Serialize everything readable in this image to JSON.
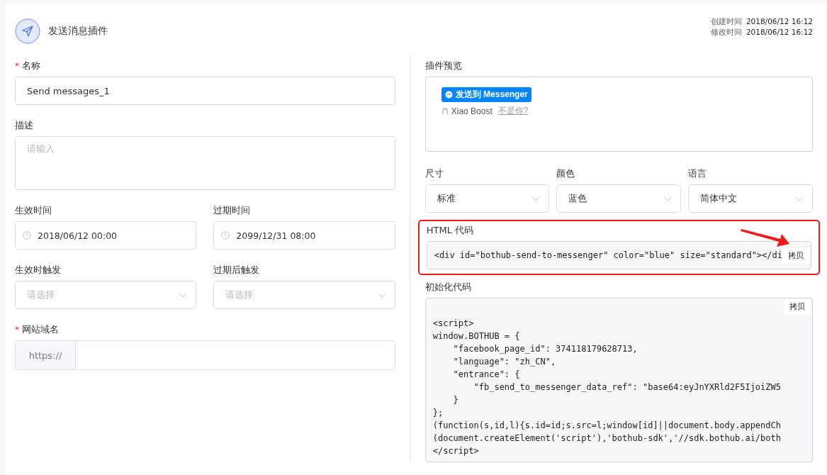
{
  "header": {
    "title": "发送消息插件",
    "created_label": "创建时间",
    "created": "2018/06/12 16:12",
    "modified_label": "修改时间",
    "modified": "2018/06/12 16:12"
  },
  "form": [
    [
      {
        "kind": "text",
        "required_mark": "*",
        "label": "名称",
        "value": "Send messages_1"
      }
    ],
    [
      {
        "kind": "textarea",
        "label": "描述",
        "placeholder": "请输入"
      }
    ],
    [
      {
        "kind": "date",
        "label": "生效时间",
        "value": "2018/06/12 00:00"
      },
      {
        "kind": "date",
        "label": "过期时间",
        "value": "2099/12/31 08:00"
      }
    ],
    [
      {
        "kind": "select",
        "label": "生效时触发",
        "placeholder": "请选择"
      },
      {
        "kind": "select",
        "label": "过期后触发",
        "placeholder": "请选择"
      }
    ],
    [
      {
        "kind": "addon",
        "required_mark": "*",
        "label": "网站域名",
        "prefix": "https://"
      }
    ]
  ],
  "preview": {
    "label": "插件预览",
    "button": "发送到 Messenger",
    "user": "Xiao Boost",
    "link": "不是你?"
  },
  "options": [
    {
      "label": "尺寸",
      "value": "标准"
    },
    {
      "label": "颜色",
      "value": "蓝色"
    },
    {
      "label": "语言",
      "value": "简体中文"
    }
  ],
  "html_code": {
    "label": "HTML 代码",
    "code": "<div id=\"bothub-send-to-messenger\" color=\"blue\" size=\"standard\"></di",
    "copy": "拷贝"
  },
  "init_code": {
    "label": "初始化代码",
    "copy": "拷贝",
    "lines": [
      "<script>",
      "window.BOTHUB = {",
      "    \"facebook_page_id\": 374118179628713,",
      "    \"language\": \"zh_CN\",",
      "    \"entrance\": {",
      "        \"fb_send_to_messenger_data_ref\": \"base64:eyJnYXRld2F5IjoiZW5",
      "    }",
      "};",
      "(function(s,id,l){s.id=id;s.src=l;window[id]||document.body.appendCh",
      "(document.createElement('script'),'bothub-sdk','//sdk.bothub.ai/both",
      "</script>"
    ]
  }
}
